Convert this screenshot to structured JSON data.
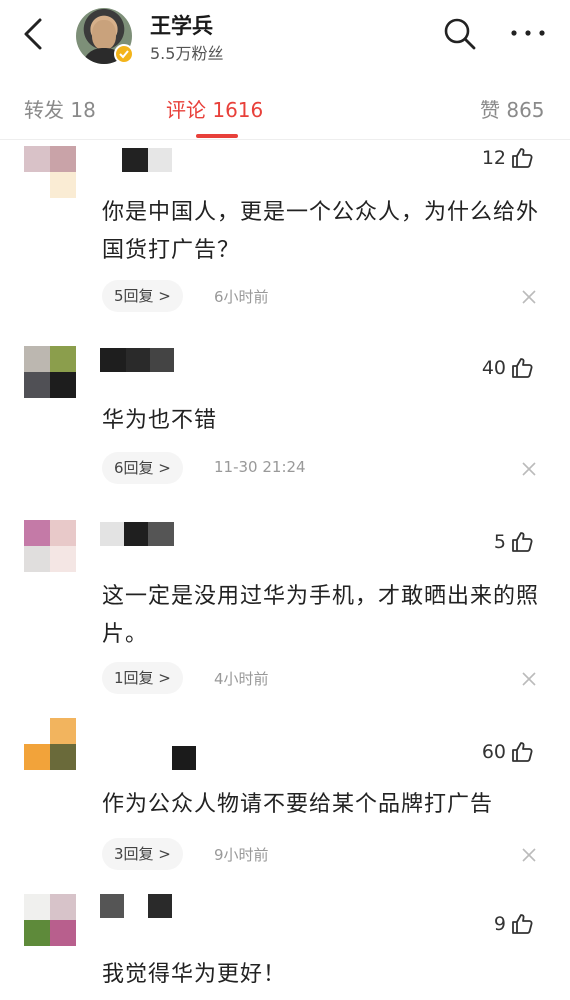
{
  "header": {
    "username": "王学兵",
    "fans": "5.5万粉丝"
  },
  "tabs": {
    "repost": "转发 18",
    "comments": "评论 1616",
    "likes": "赞 865"
  },
  "comments": [
    {
      "likes": "12",
      "text": "你是中国人，更是一个公众人，为什么给外国货打广告？",
      "replies": "5回复 >",
      "time": "6小时前"
    },
    {
      "likes": "40",
      "text": "华为也不错",
      "replies": "6回复 >",
      "time": "11-30 21:24"
    },
    {
      "likes": "5",
      "text": "这一定是没用过华为手机，才敢晒出来的照片。",
      "replies": "1回复 >",
      "time": "4小时前"
    },
    {
      "likes": "60",
      "text": "作为公众人物请不要给某个品牌打广告",
      "replies": "3回复 >",
      "time": "9小时前"
    },
    {
      "likes": "9",
      "text": "我觉得华为更好！"
    }
  ],
  "colors": {
    "accent": "#e8403a",
    "verified_badge": "#f3b41b"
  },
  "icons": [
    "back-arrow-icon",
    "search-icon",
    "more-icon",
    "thumb-up-icon",
    "close-icon",
    "verified-badge-icon"
  ]
}
